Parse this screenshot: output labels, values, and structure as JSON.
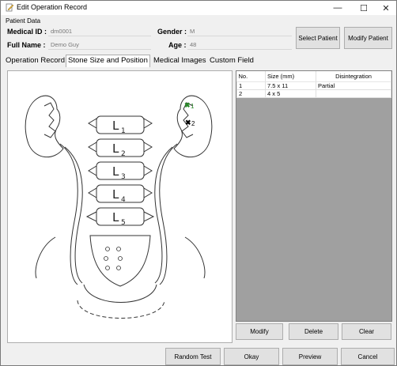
{
  "window": {
    "title": "Edit Operation Record",
    "controls": [
      "—",
      "☐",
      "✕"
    ]
  },
  "patient": {
    "group_label": "Patient Data",
    "medical_id_label": "Medical ID :",
    "medical_id_value": "dm0001",
    "full_name_label": "Full Name :",
    "full_name_value": "Demo Guy",
    "gender_label": "Gender :",
    "gender_value": "M",
    "age_label": "Age :",
    "age_value": "48",
    "select_button": "Select Patient",
    "modify_button": "Modify Patient"
  },
  "tabs": [
    "Operation Record",
    "Stone Size and Position",
    "Medical Images",
    "Custom Field"
  ],
  "active_tab": 1,
  "diagram": {
    "vertebrae": [
      "L1",
      "L2",
      "L3",
      "L4",
      "L5"
    ],
    "stone_markers": [
      "1",
      "2"
    ]
  },
  "stones_table": {
    "columns": [
      "No.",
      "Size (mm)",
      "Disintegration"
    ],
    "rows": [
      [
        "1",
        "7.5 x 11",
        "Partial"
      ],
      [
        "2",
        "4 x 5",
        ""
      ]
    ]
  },
  "table_buttons": {
    "modify": "Modify",
    "delete": "Delete",
    "clear": "Clear"
  },
  "footer": {
    "random_test": "Random Test",
    "okay": "Okay",
    "preview": "Preview",
    "cancel": "Cancel"
  }
}
